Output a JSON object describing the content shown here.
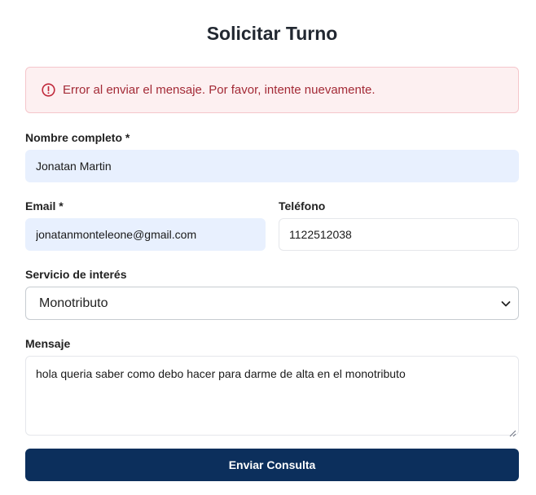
{
  "page": {
    "title": "Solicitar Turno"
  },
  "alert": {
    "message": "Error al enviar el mensaje. Por favor, intente nuevamente.",
    "icon": "alert-circle-icon",
    "color": "#a32a36"
  },
  "form": {
    "name": {
      "label": "Nombre completo *",
      "value": "Jonatan Martin"
    },
    "email": {
      "label": "Email *",
      "value": "jonatanmonteleone@gmail.com"
    },
    "phone": {
      "label": "Teléfono",
      "value": "1122512038"
    },
    "service": {
      "label": "Servicio de interés",
      "value": "Monotributo"
    },
    "message": {
      "label": "Mensaje",
      "value": "hola queria saber como debo hacer para darme de alta en el monotributo"
    },
    "submit_label": "Enviar Consulta"
  },
  "colors": {
    "primary": "#0c2f5c",
    "autofill": "#e8f0fe",
    "alert_bg": "#fdf0f1"
  }
}
